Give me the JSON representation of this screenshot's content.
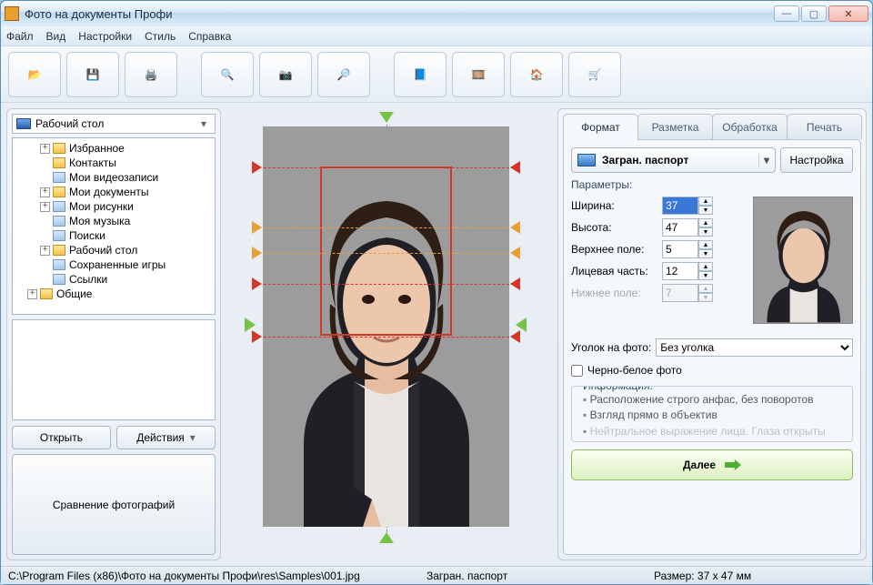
{
  "window": {
    "title": "Фото на документы Профи"
  },
  "menu": [
    "Файл",
    "Вид",
    "Настройки",
    "Стиль",
    "Справка"
  ],
  "toolbar_icons": [
    "open-icon",
    "save-icon",
    "print-icon",
    "user-search-icon",
    "camera-icon",
    "image-search-icon",
    "help-book-icon",
    "effects-icon",
    "home-icon",
    "cart-icon"
  ],
  "toolbar_glyphs": [
    "📂",
    "💾",
    "🖨️",
    "🔍",
    "📷",
    "🔎",
    "📘",
    "🎞️",
    "🏠",
    "🛒"
  ],
  "folder_bar": "Рабочий стол",
  "tree": [
    {
      "ind": 30,
      "exp": "+",
      "lbl": "Избранное",
      "ico": "fico"
    },
    {
      "ind": 30,
      "exp": "",
      "lbl": "Контакты",
      "ico": "fico"
    },
    {
      "ind": 30,
      "exp": "",
      "lbl": "Мои видеозаписи",
      "ico": "fico grey"
    },
    {
      "ind": 30,
      "exp": "+",
      "lbl": "Мои документы",
      "ico": "fico"
    },
    {
      "ind": 30,
      "exp": "+",
      "lbl": "Мои рисунки",
      "ico": "fico grey"
    },
    {
      "ind": 30,
      "exp": "",
      "lbl": "Моя музыка",
      "ico": "fico grey"
    },
    {
      "ind": 30,
      "exp": "",
      "lbl": "Поиски",
      "ico": "fico grey"
    },
    {
      "ind": 30,
      "exp": "+",
      "lbl": "Рабочий стол",
      "ico": "fico"
    },
    {
      "ind": 30,
      "exp": "",
      "lbl": "Сохраненные игры",
      "ico": "fico grey"
    },
    {
      "ind": 30,
      "exp": "",
      "lbl": "Ссылки",
      "ico": "fico grey"
    },
    {
      "ind": 16,
      "exp": "+",
      "lbl": "Общие",
      "ico": "fico"
    }
  ],
  "lp_buttons": {
    "open": "Открыть",
    "actions": "Действия",
    "compare": "Сравнение фотографий"
  },
  "tabs": [
    "Формат",
    "Разметка",
    "Обработка",
    "Печать"
  ],
  "active_tab": 0,
  "format_selector": "Загран. паспорт",
  "setup_btn": "Настройка",
  "params_label": "Параметры:",
  "params": [
    {
      "label": "Ширина:",
      "value": "37",
      "selected": true
    },
    {
      "label": "Высота:",
      "value": "47"
    },
    {
      "label": "Верхнее поле:",
      "value": "5"
    },
    {
      "label": "Лицевая часть:",
      "value": "12"
    },
    {
      "label": "Нижнее поле:",
      "value": "7",
      "disabled": true
    }
  ],
  "corner": {
    "label": "Уголок на фото:",
    "value": "Без уголка"
  },
  "bw": {
    "label": "Черно-белое фото"
  },
  "info": {
    "title": "Информация:",
    "items": [
      "Расположение строго анфас, без поворотов",
      "Взгляд прямо в объектив",
      "Нейтральное выражение лица. Глаза открыты"
    ]
  },
  "next": "Далее",
  "status": {
    "path": "C:\\Program Files (x86)\\Фото на документы Профи\\res\\Samples\\001.jpg",
    "format": "Загран. паспорт",
    "size": "Размер: 37 x 47 мм"
  }
}
